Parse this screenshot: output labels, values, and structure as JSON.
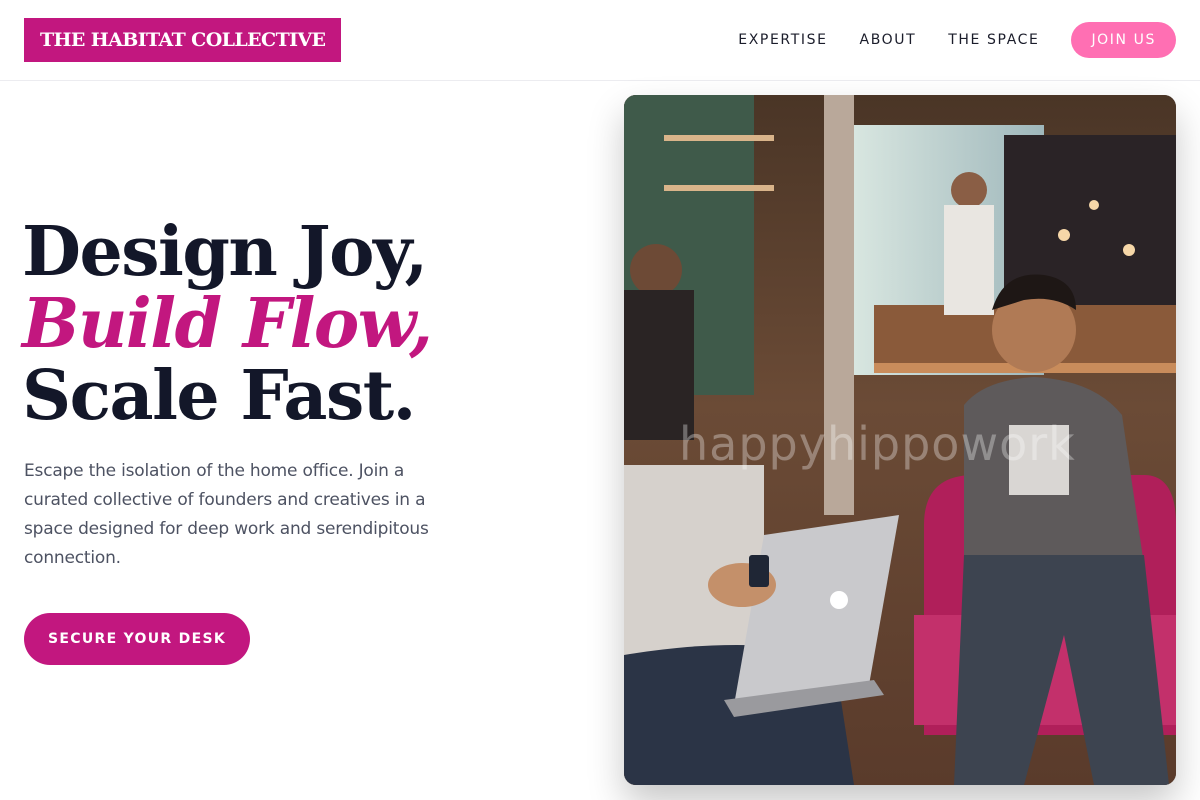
{
  "brand": {
    "name": "THE HABITAT COLLECTIVE",
    "color": "#c2177f"
  },
  "nav": {
    "items": [
      {
        "label": "EXPERTISE"
      },
      {
        "label": "ABOUT"
      },
      {
        "label": "THE SPACE"
      }
    ],
    "join_label": "JOIN US",
    "join_color": "#ff6fb3"
  },
  "hero": {
    "headline_line1": "Design Joy,",
    "headline_line2": "Build Flow,",
    "headline_line3": "Scale Fast.",
    "description": "Escape the isolation of the home office. Join a curated collective of founders and creatives in a space designed for deep work and serendipitous connection.",
    "cta_label": "SECURE YOUR DESK",
    "image_watermark": "happyhippowork"
  }
}
